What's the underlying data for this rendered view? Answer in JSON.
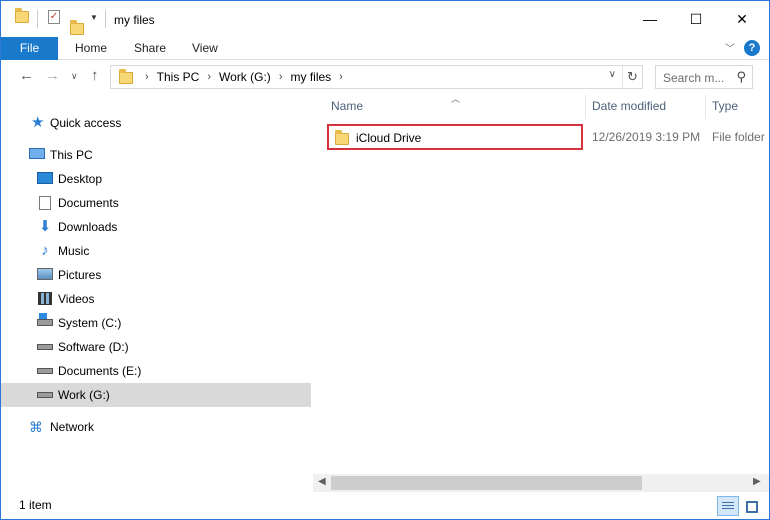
{
  "window": {
    "title": "my files"
  },
  "titlebar": {
    "minimize": "—",
    "maximize": "☐",
    "close": "✕"
  },
  "ribbon": {
    "tabs": [
      "File",
      "Home",
      "Share",
      "View"
    ],
    "collapse_icon": "chevron-down-icon",
    "help": "?"
  },
  "address": {
    "breadcrumbs": [
      "This PC",
      "Work (G:)",
      "my files"
    ],
    "search_placeholder": "Search m..."
  },
  "sidebar": {
    "items": [
      {
        "label": "Quick access",
        "icon": "star-icon"
      },
      {
        "label": "This PC",
        "icon": "computer-icon"
      },
      {
        "label": "Desktop",
        "icon": "desktop-icon"
      },
      {
        "label": "Documents",
        "icon": "documents-icon"
      },
      {
        "label": "Downloads",
        "icon": "downloads-icon"
      },
      {
        "label": "Music",
        "icon": "music-icon"
      },
      {
        "label": "Pictures",
        "icon": "pictures-icon"
      },
      {
        "label": "Videos",
        "icon": "videos-icon"
      },
      {
        "label": "System (C:)",
        "icon": "system-drive-icon"
      },
      {
        "label": "Software (D:)",
        "icon": "drive-icon"
      },
      {
        "label": "Documents (E:)",
        "icon": "drive-icon"
      },
      {
        "label": "Work (G:)",
        "icon": "drive-icon",
        "selected": true
      },
      {
        "label": "Network",
        "icon": "network-icon"
      }
    ]
  },
  "columns": {
    "name": "Name",
    "date": "Date modified",
    "type": "Type"
  },
  "files": [
    {
      "name": "iCloud Drive",
      "date": "12/26/2019 3:19 PM",
      "type": "File folder",
      "highlighted": true
    }
  ],
  "status": {
    "text": "1 item"
  },
  "colors": {
    "accent": "#1979ca",
    "highlight_border": "#d8313e",
    "selected_bg": "#d9d9d9"
  }
}
